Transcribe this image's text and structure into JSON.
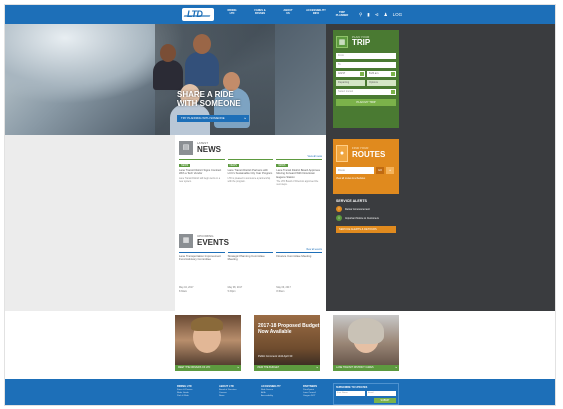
{
  "header": {
    "logo_text": "LTD",
    "nav": [
      {
        "line1": "RIDING",
        "line2": "LTD"
      },
      {
        "line1": "FARES &",
        "line2": "PASSES"
      },
      {
        "line1": "ABOUT",
        "line2": "US"
      },
      {
        "line1": "ACCESSIBILITY",
        "line2": "INFO"
      }
    ],
    "trip_planner_label": "TRIP PLANNER",
    "login_label": "LOG"
  },
  "hero": {
    "headline_1": "SHARE A RIDE",
    "headline_2": "WITH SOMEONE",
    "cta": "TRY PLANNING WITH SOMEONE"
  },
  "trip": {
    "small": "PLAN YOUR",
    "big": "TRIP",
    "from_placeholder": "From",
    "to_placeholder": "To",
    "date": "4/3/17",
    "time": "8:26 am",
    "depart": "Departing",
    "options": "Options",
    "option_select": "Select transit",
    "button": "PLAN MY TRIP"
  },
  "routes": {
    "small": "FIND YOUR",
    "big": "ROUTES",
    "placeholder": "Route",
    "go": "GO",
    "link": "View all routes & schedules",
    "alerts_title": "SERVICE ALERTS",
    "alerts": [
      {
        "icon": "!",
        "text": "Detour Announcement"
      },
      {
        "icon": "i",
        "text": "Important Notice to Customers"
      }
    ],
    "alerts_button": "SERVICE ALERTS & DETOURS"
  },
  "news": {
    "small": "LATEST",
    "big": "NEWS",
    "view_all": "View all news",
    "items": [
      {
        "badge": "NEWS",
        "title": "Lane Transit District Signs Contract With a Tech Vendor",
        "body": "Lane Transit District will begin work on a new system."
      },
      {
        "badge": "NEWS",
        "title": "Lane Transit District Partners with LCC's Sustainable City Year Program",
        "body": "LTD is pleased to announce a partnership with the program."
      },
      {
        "badge": "NEWS",
        "title": "Lane Transit District Board Approves Moving Forward With Downtown Eugene Station",
        "body": "The LTD Board of Directors approved the next steps."
      }
    ]
  },
  "events": {
    "small": "UPCOMING",
    "big": "EVENTS",
    "view_all": "View all events",
    "items": [
      {
        "title": "Lane Transportation Improvement Fund Advisory Committee",
        "date": "May 04, 2017",
        "time": "8:30am"
      },
      {
        "title": "Strategic Planning Committee Meeting",
        "date": "May 08, 2017",
        "time": "5:30pm"
      },
      {
        "title": "Finance Committee Meeting",
        "date": "May 09, 2017",
        "time": "8:30am"
      }
    ]
  },
  "promos": [
    {
      "bar": "MEET THE DRIVERS OF LTD"
    },
    {
      "headline": "2017-18 Proposed Budget Now Available",
      "sub": "Public Comment Until April 30",
      "bar": "VIEW THE BUDGET"
    },
    {
      "bar": "LANE TRANSIT DISTRICT CARES"
    }
  ],
  "footer": {
    "columns": [
      {
        "head": "RIDING LTD",
        "links": [
          "Fares & Passes",
          "Rider Guide",
          "Park & Ride"
        ]
      },
      {
        "head": "ABOUT LTD",
        "links": [
          "Board of Directors",
          "Careers",
          "News"
        ]
      },
      {
        "head": "ACCESSIBILITY",
        "links": [
          "Ride Source",
          "ADA",
          "Accessibility"
        ]
      },
      {
        "head": "PARTNERS",
        "links": [
          "Point2point",
          "Lane Council",
          "Oregon DOT"
        ]
      }
    ],
    "subscribe_title": "SUBSCRIBE TO UPDATES",
    "first_name": "First Name",
    "email": "Email",
    "submit": "SUBMIT"
  },
  "colors": {
    "brand_blue": "#1d6fb8",
    "green": "#5d9a3f",
    "orange": "#e08a1e",
    "dark_panel": "#3a3c3f"
  }
}
